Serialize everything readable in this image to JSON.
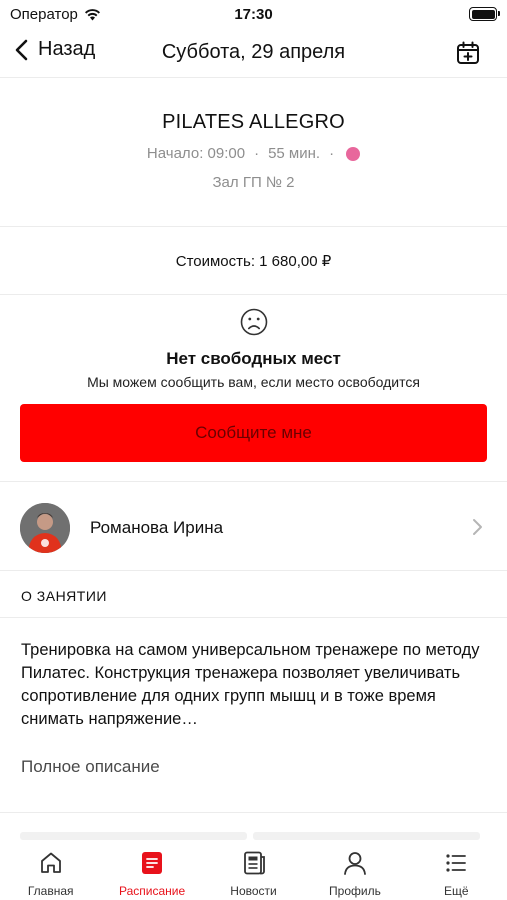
{
  "status_bar": {
    "carrier": "Оператор",
    "time": "17:30"
  },
  "nav": {
    "back_label": "Назад",
    "title": "Суббота, 29 апреля"
  },
  "class_info": {
    "title": "PILATES ALLEGRO",
    "start": "Начало: 09:00",
    "separator": "·",
    "duration": "55 мин.",
    "room": "Зал ГП № 2",
    "category_color": "#e8679c"
  },
  "price": {
    "label": "Стоимость: 1 680,00 ₽"
  },
  "availability": {
    "title": "Нет свободных мест",
    "subtitle": "Мы можем сообщить вам, если место освободится",
    "notify_button": "Сообщите мне",
    "button_color": "#ff0000"
  },
  "trainer": {
    "name": "Романова Ирина"
  },
  "about": {
    "header": "О ЗАНЯТИИ",
    "description": "Тренировка на самом универсальном тренажере по методу Пилатес. Конструкция тренажера позволяет увеличивать сопротивление для одних групп мышц и в тоже время снимать напряжение…",
    "full_link": "Полное описание"
  },
  "tabs": [
    {
      "label": "Главная",
      "icon": "home-icon",
      "active": false
    },
    {
      "label": "Расписание",
      "icon": "schedule-icon",
      "active": true
    },
    {
      "label": "Новости",
      "icon": "news-icon",
      "active": false
    },
    {
      "label": "Профиль",
      "icon": "profile-icon",
      "active": false
    },
    {
      "label": "Ещё",
      "icon": "more-icon",
      "active": false
    }
  ],
  "accent_color": "#e8121b"
}
